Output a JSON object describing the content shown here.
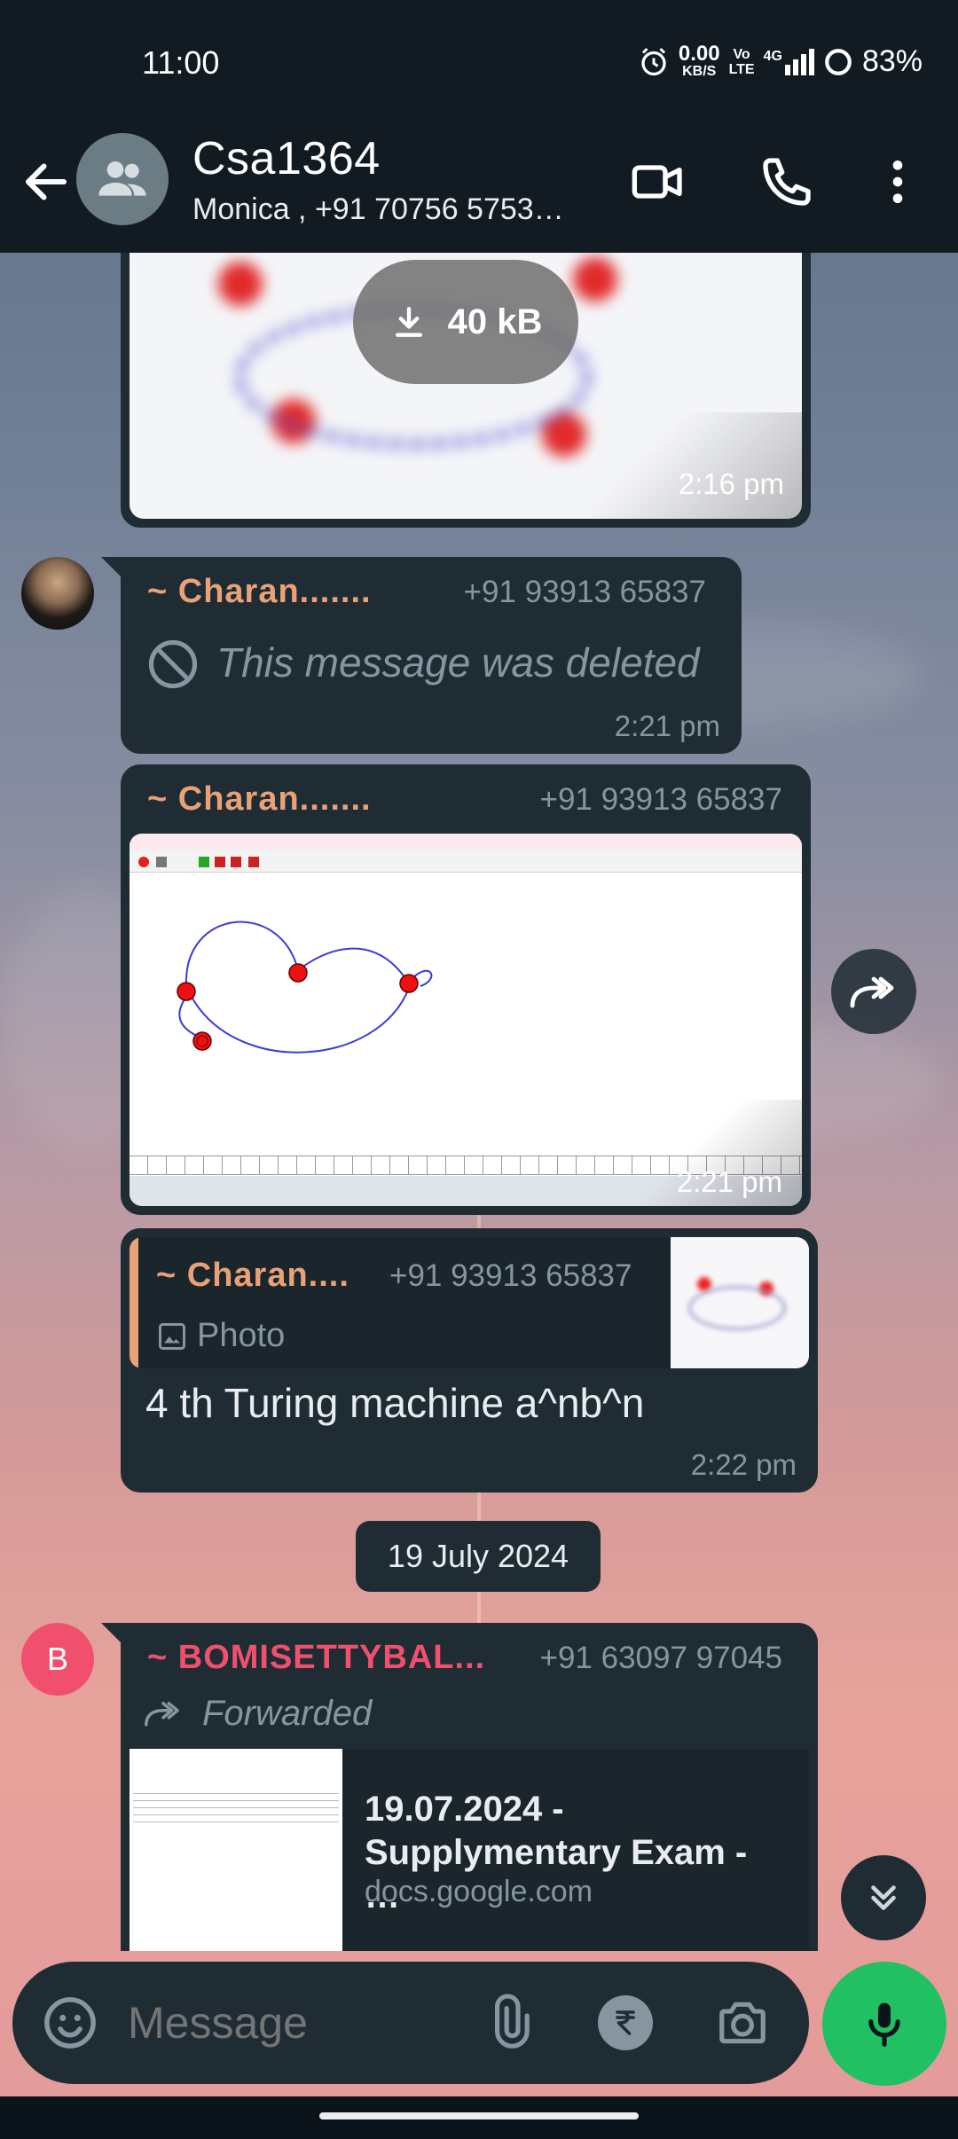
{
  "status_bar": {
    "time": "11:00",
    "net_speed_value": "0.00",
    "net_speed_unit": "KB/S",
    "volte_top": "Vo",
    "volte_bottom": "LTE",
    "network": "4G",
    "battery": "83%"
  },
  "header": {
    "title": "Csa1364",
    "subtitle": "Monica , +91 70756 5753…"
  },
  "messages": {
    "image_download_size": "40 kB",
    "image1_time": "2:16 pm",
    "deleted": {
      "sender": "~ Charan.......",
      "phone": "+91 93913 65837",
      "text": "This message was deleted",
      "time": "2:21 pm"
    },
    "photo": {
      "sender": "~ Charan.......",
      "phone": "+91 93913 65837",
      "time": "2:21 pm"
    },
    "reply": {
      "quoted_sender": "~ Charan....",
      "quoted_phone": "+91 93913 65837",
      "quoted_type": "Photo",
      "text": "4 th Turing machine a^nb^n",
      "time": "2:22 pm"
    },
    "date_chip": "19 July 2024",
    "forwarded": {
      "avatar_letter": "B",
      "sender": "~ BOMISETTYBAL...",
      "phone": "+91 63097 97045",
      "forward_label": "Forwarded",
      "link_title": "19.07.2024 - Supplymentary Exam - …",
      "link_domain": "docs.google.com"
    }
  },
  "input": {
    "placeholder": "Message"
  },
  "colors": {
    "bubble": "#1f2c34",
    "header": "#121b22",
    "sender_orange": "#e9a277",
    "sender_red": "#f0506e",
    "mic_green": "#21c063"
  }
}
